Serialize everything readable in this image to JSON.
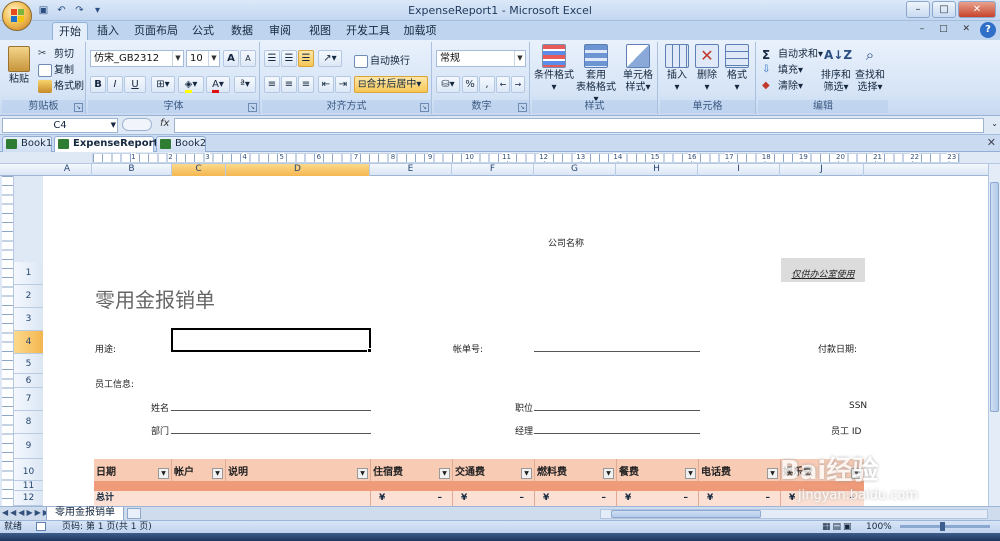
{
  "window": {
    "title": "ExpenseReport1 - Microsoft Excel"
  },
  "ribbon_tabs": [
    "开始",
    "插入",
    "页面布局",
    "公式",
    "数据",
    "审阅",
    "视图",
    "开发工具",
    "加载项"
  ],
  "clipboard": {
    "paste": "粘贴",
    "cut": "剪切",
    "copy": "复制",
    "format_painter": "格式刷",
    "label": "剪贴板"
  },
  "font": {
    "name": "仿宋_GB2312",
    "size": "10",
    "bold": "B",
    "italic": "I",
    "underline": "U",
    "grow": "A",
    "shrink": "A",
    "color_letter": "A",
    "label": "字体"
  },
  "alignment": {
    "wrap": "自动换行",
    "merge": "合并后居中",
    "label": "对齐方式"
  },
  "number": {
    "format": "常规",
    "percent": "%",
    "comma": ",",
    "label": "数字"
  },
  "styles": {
    "conditional": "条件格式",
    "table_format_1": "套用",
    "table_format_2": "表格格式",
    "cell_styles_1": "单元格",
    "cell_styles_2": "样式",
    "label": "样式"
  },
  "cells": {
    "insert": "插入",
    "delete": "删除",
    "format": "格式",
    "label": "单元格"
  },
  "editing": {
    "autosum": "自动求和",
    "fill": "填充",
    "clear": "清除",
    "sort_1": "排序和",
    "sort_2": "筛选",
    "find_1": "查找和",
    "find_2": "选择",
    "label": "编辑"
  },
  "formula_bar": {
    "name_box": "C4",
    "fx": "fx",
    "value": ""
  },
  "workbooks": [
    "Book1",
    "ExpenseReport1 *",
    "Book2"
  ],
  "ruler_numbers": [
    "1",
    "2",
    "3",
    "4",
    "5",
    "6",
    "7",
    "8",
    "9",
    "10",
    "11",
    "12",
    "13",
    "14",
    "15",
    "16",
    "17",
    "18",
    "19",
    "20",
    "21",
    "22",
    "23"
  ],
  "columns": [
    "A",
    "B",
    "C",
    "D",
    "E",
    "F",
    "G",
    "H",
    "I",
    "J"
  ],
  "rows": [
    "1",
    "2",
    "3",
    "4",
    "5",
    "6",
    "7",
    "8",
    "9",
    "10",
    "11",
    "12"
  ],
  "sheet": {
    "company": "公司名称",
    "title": "零用金报销单",
    "office_use": "仅供办公室使用",
    "purpose_label": "用途:",
    "statement_label": "帐单号:",
    "pay_date_label": "付款日期:",
    "employee_info_label": "员工信息:",
    "name_label": "姓名",
    "position_label": "职位",
    "ssn_label": "SSN",
    "dept_label": "部门",
    "manager_label": "经理",
    "employee_id_label": "员工 ID",
    "headers": [
      "日期",
      "帐户",
      "说明",
      "住宿费",
      "交通费",
      "燃料费",
      "餐费",
      "电话费",
      "娱乐费"
    ],
    "total_label": "总计",
    "currency": "¥",
    "dash": "–"
  },
  "sheet_tab": "零用金报销单",
  "status": {
    "ready": "就绪",
    "page": "页码: 第 1 页(共 1 页)",
    "zoom": "100%"
  },
  "watermark": {
    "brand": "Bai经验",
    "url": "jingyan.baidu.com"
  }
}
